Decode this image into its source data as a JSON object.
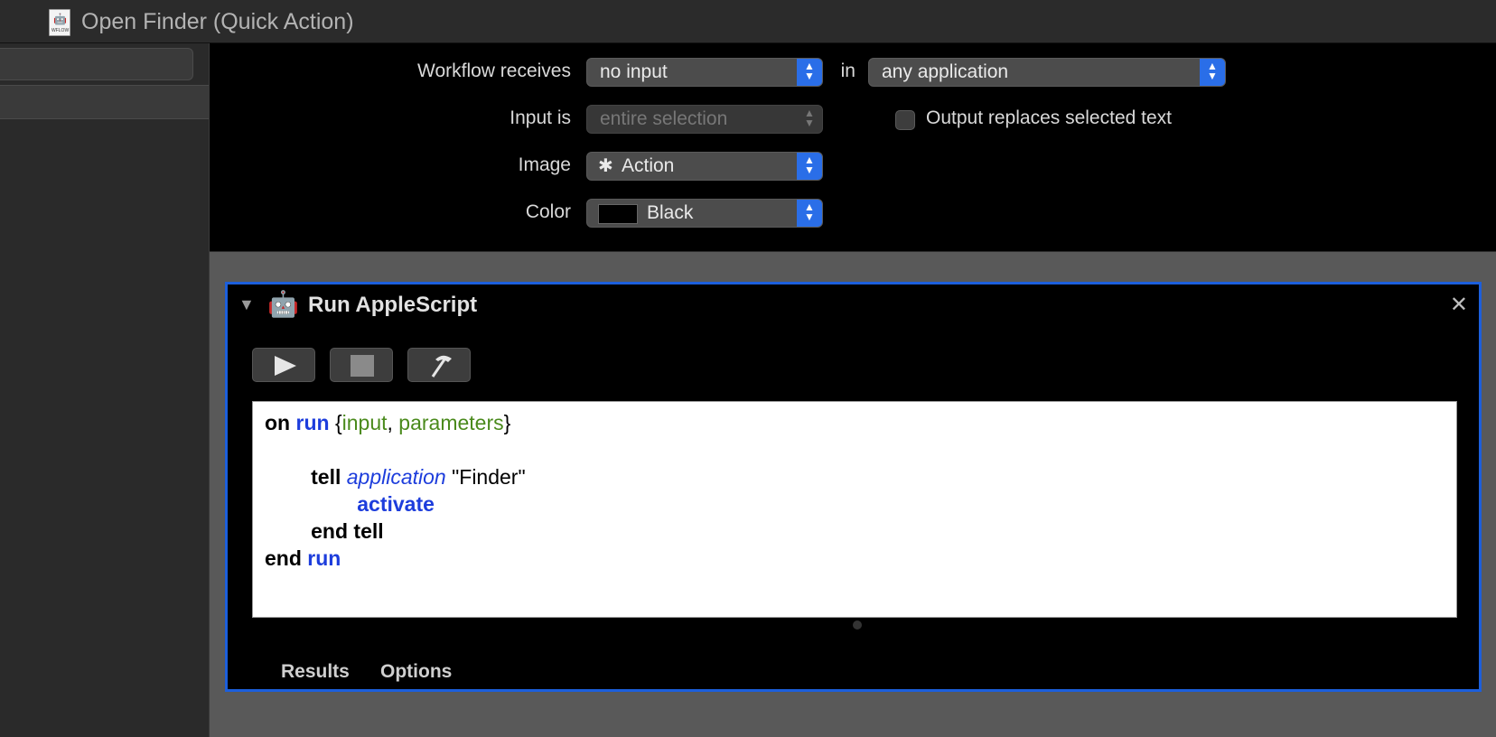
{
  "window": {
    "title": "Open Finder (Quick Action)",
    "doc_icon_label": "WFLOW",
    "doc_icon": "workflow-doc-icon"
  },
  "config": {
    "workflow_receives_label": "Workflow receives",
    "workflow_receives_value": "no input",
    "in_label": "in",
    "in_value": "any application",
    "input_is_label": "Input is",
    "input_is_value": "entire selection",
    "output_replaces_label": "Output replaces selected text",
    "output_replaces_checked": false,
    "image_label": "Image",
    "image_value": "Action",
    "image_icon": "gear-icon",
    "color_label": "Color",
    "color_value": "Black",
    "color_swatch": "#000000"
  },
  "action": {
    "title": "Run AppleScript",
    "icon": "automator-robot-icon",
    "toolbar": [
      "play-icon",
      "stop-icon",
      "hammer-icon"
    ],
    "code": {
      "line1_on": "on",
      "line1_run": "run",
      "line1_open": "{",
      "line1_input": "input",
      "line1_comma": ",",
      "line1_params": "parameters",
      "line1_close": "}",
      "line3_tell": "tell",
      "line3_app": "application",
      "line3_str": "\"Finder\"",
      "line4_activate": "activate",
      "line5_end_tell": "end tell",
      "line6_end": "end",
      "line6_run": "run"
    },
    "tabs": [
      "Results",
      "Options"
    ]
  },
  "colors": {
    "accent": "#2a6ee8",
    "selection_border": "#1c5fdc",
    "keyword_blue": "#1d3ddc",
    "variable_green": "#4a8a1c"
  }
}
